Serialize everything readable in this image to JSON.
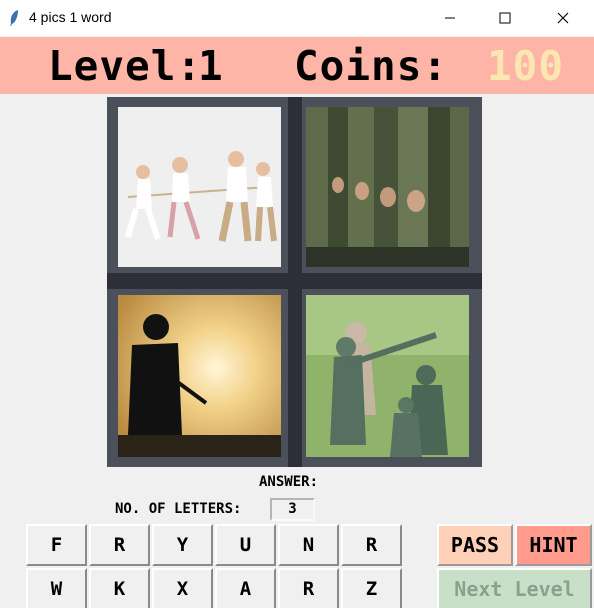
{
  "window": {
    "title": "4 pics 1 word",
    "icon": "feather-icon",
    "controls": [
      "minimize-icon",
      "maximize-icon",
      "close-icon"
    ]
  },
  "header": {
    "level_label": "Level:",
    "level_value": "1",
    "coins_label": "Coins:",
    "coins_value": "100",
    "background": "#ffb4a8",
    "coins_color": "#fde7b0"
  },
  "pictures": [
    {
      "name": "tug-of-war children",
      "icon": "tug-of-war-photo"
    },
    {
      "name": "row of soldiers",
      "icon": "soldiers-row-photo"
    },
    {
      "name": "soldier silhouette at sunset",
      "icon": "soldier-silhouette-photo"
    },
    {
      "name": "green toy army men",
      "icon": "toy-soldiers-photo"
    }
  ],
  "answer": {
    "label": "ANSWER:",
    "letters_label": "NO. OF LETTERS:",
    "letters_count": "3"
  },
  "keyboard": {
    "row1": [
      "F",
      "R",
      "Y",
      "U",
      "N",
      "R"
    ],
    "row2": [
      "W",
      "K",
      "X",
      "A",
      "R",
      "Z"
    ]
  },
  "buttons": {
    "pass": "PASS",
    "hint": "HINT",
    "next_level": "Next Level",
    "pass_color": "#ffd0b8",
    "hint_color": "#ff9a8c",
    "next_color": "#c8e0c8"
  }
}
